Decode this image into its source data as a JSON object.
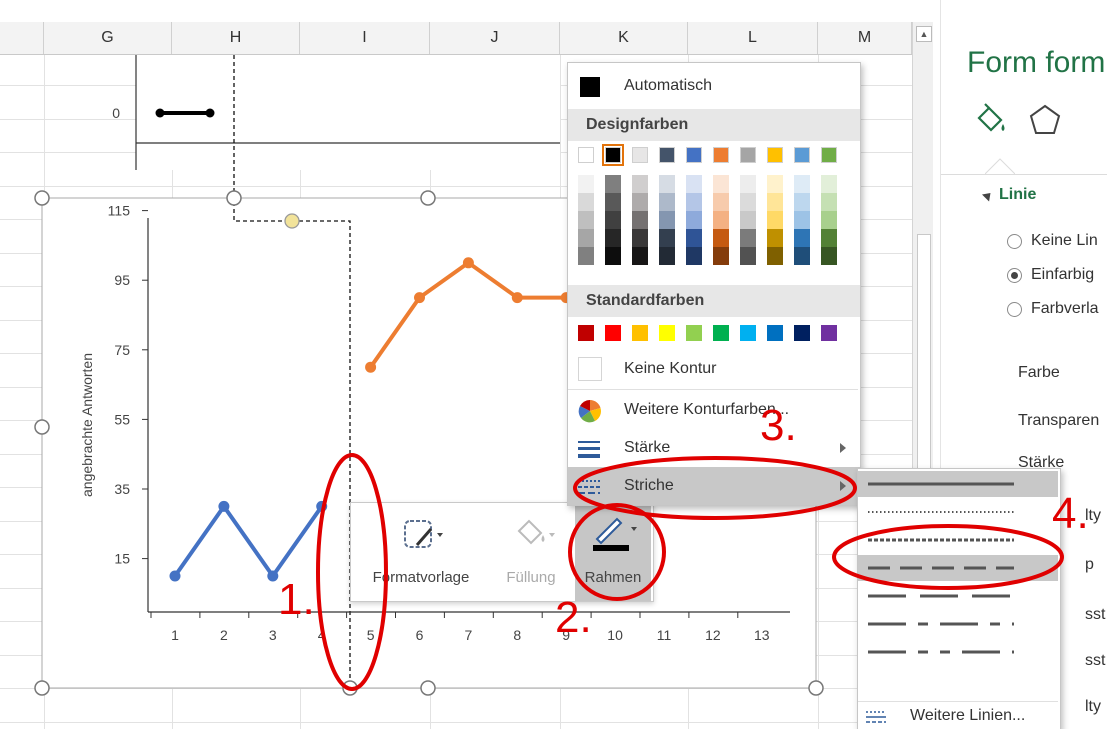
{
  "columns": [
    "G",
    "H",
    "I",
    "J",
    "K",
    "L",
    "M"
  ],
  "pane": {
    "title": "Form form",
    "section": "Linie",
    "options": [
      "Keine Lin",
      "Einfarbig",
      "Farbverla"
    ],
    "rows": [
      "Farbe",
      "Transparen",
      "Stärke",
      "lty",
      "p",
      "sst",
      "sst",
      "lty"
    ]
  },
  "chart_data": {
    "type": "line",
    "ylabel": "angebrachte Antworten",
    "xlabel": "",
    "x": [
      1,
      2,
      3,
      4,
      5,
      6,
      7,
      8,
      9,
      10,
      11,
      12,
      13
    ],
    "x_ticks": [
      "1",
      "2",
      "3",
      "4",
      "5",
      "6",
      "7",
      "8",
      "9",
      "10",
      "11",
      "12",
      "13"
    ],
    "y_ticks": [
      "15",
      "35",
      "55",
      "75",
      "95",
      "115"
    ],
    "ylim": [
      0,
      115
    ],
    "series": [
      {
        "color": "#4472c4",
        "x": [
          1,
          2,
          3,
          4
        ],
        "values": [
          10,
          30,
          10,
          30
        ]
      },
      {
        "color": "#ed7d31",
        "x": [
          5,
          6,
          7,
          8,
          9
        ],
        "values": [
          70,
          90,
          100,
          90,
          90
        ]
      }
    ],
    "top_chart": {
      "y_tick": "0",
      "segment_x": [
        1,
        2
      ],
      "segment_y": [
        0,
        0
      ]
    }
  },
  "toolbar": {
    "formatvorlage": "Formatvorlage",
    "fuellung": "Füllung",
    "rahmen": "Rahmen"
  },
  "colormenu": {
    "automatic": "Automatisch",
    "design_header": "Designfarben",
    "standard_header": "Standardfarben",
    "no_outline": "Keine Kontur",
    "more_colors": "Weitere Konturfarben...",
    "weight": "Stärke",
    "dashes": "Striche",
    "theme_colors": [
      "#ffffff",
      "#000000",
      "#e7e6e6",
      "#44546a",
      "#4472c4",
      "#ed7d31",
      "#a5a5a5",
      "#ffc000",
      "#5b9bd5",
      "#70ad47"
    ],
    "standard_colors": [
      "#c00000",
      "#ff0000",
      "#ffc000",
      "#ffff00",
      "#92d050",
      "#00b050",
      "#00b0f0",
      "#0070c0",
      "#002060",
      "#7030a0"
    ]
  },
  "dashmenu": {
    "more_lines": "Weitere Linien..."
  },
  "annotations": [
    "1.",
    "2.",
    "3.",
    "4."
  ]
}
